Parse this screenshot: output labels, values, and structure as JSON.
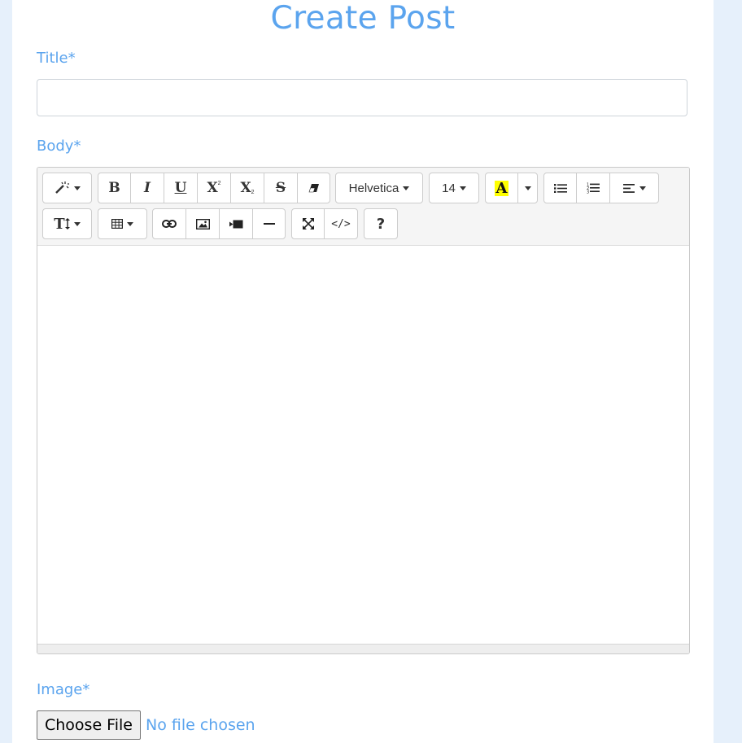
{
  "page": {
    "title": "Create Post"
  },
  "form": {
    "title_label": "Title*",
    "title_value": "",
    "body_label": "Body*",
    "image_label": "Image*",
    "choose_file_label": "Choose File",
    "file_status": "No file chosen"
  },
  "toolbar": {
    "font_family": "Helvetica",
    "font_size": "14",
    "color_letter": "A",
    "help_label": "?",
    "bold": "B",
    "italic": "I",
    "underline": "U",
    "superscript": "X",
    "subscript": "X",
    "strikethrough": "S",
    "font_size_glyph": "T",
    "codeview": "</>"
  },
  "colors": {
    "accent": "#5ba4ee",
    "page_bg": "#e6f0fb",
    "highlight": "#ffff00"
  }
}
